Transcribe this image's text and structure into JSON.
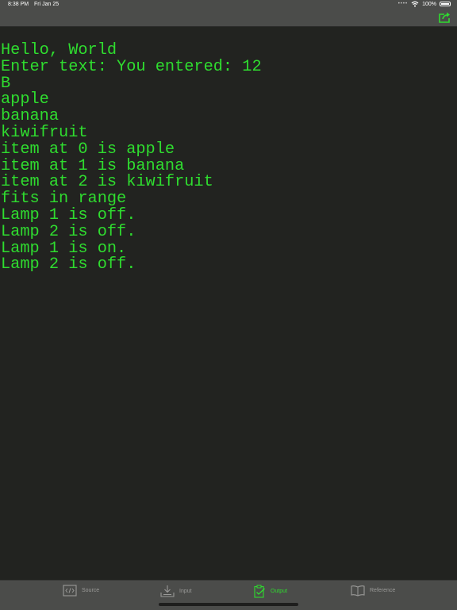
{
  "status_bar": {
    "time": "8:38 PM",
    "date": "Fri Jan 25",
    "dots": "••••",
    "battery": "100%"
  },
  "toolbar": {
    "share_icon": "share-icon"
  },
  "output": {
    "lines": [
      "Hello, World",
      "Enter text: You entered: 12",
      "B",
      "apple",
      "banana",
      "kiwifruit",
      "item at 0 is apple",
      "item at 1 is banana",
      "item at 2 is kiwifruit",
      "fits in range",
      "Lamp 1 is off.",
      "Lamp 2 is off.",
      "Lamp 1 is on.",
      "Lamp 2 is off."
    ],
    "text_color": "#2fdc2f",
    "background_color": "#222320"
  },
  "tabs": [
    {
      "label": "Source",
      "icon": "code-icon",
      "active": false
    },
    {
      "label": "Input",
      "icon": "download-tray-icon",
      "active": false
    },
    {
      "label": "Output",
      "icon": "clipboard-check-icon",
      "active": true
    },
    {
      "label": "Reference",
      "icon": "book-icon",
      "active": false
    }
  ],
  "colors": {
    "accent": "#2fdc2f",
    "bar_background": "#4b4c4a",
    "inactive_tab": "#9a9a98"
  }
}
